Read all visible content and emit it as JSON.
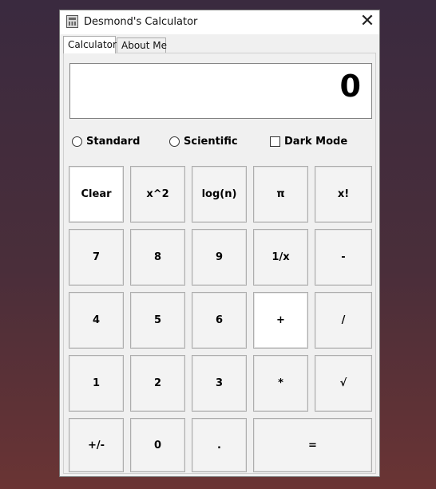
{
  "window": {
    "title": "Desmond's Calculator",
    "close_glyph": "✕"
  },
  "tabs": [
    {
      "label": "Calculator",
      "active": true
    },
    {
      "label": "About Me",
      "active": false
    }
  ],
  "display": {
    "value": "0"
  },
  "options": {
    "standard": {
      "label": "Standard",
      "selected": false
    },
    "scientific": {
      "label": "Scientific",
      "selected": false
    },
    "dark_mode": {
      "label": "Dark Mode",
      "checked": false
    }
  },
  "buttons": {
    "clear": "Clear",
    "square": "x^2",
    "log": "log(n)",
    "pi": "π",
    "factorial": "x!",
    "n7": "7",
    "n8": "8",
    "n9": "9",
    "reciprocal": "1/x",
    "minus": "-",
    "n4": "4",
    "n5": "5",
    "n6": "6",
    "plus": "+",
    "divide": "/",
    "n1": "1",
    "n2": "2",
    "n3": "3",
    "multiply": "*",
    "sqrt": "√",
    "negate": "+/-",
    "n0": "0",
    "decimal": ".",
    "equals": "="
  }
}
